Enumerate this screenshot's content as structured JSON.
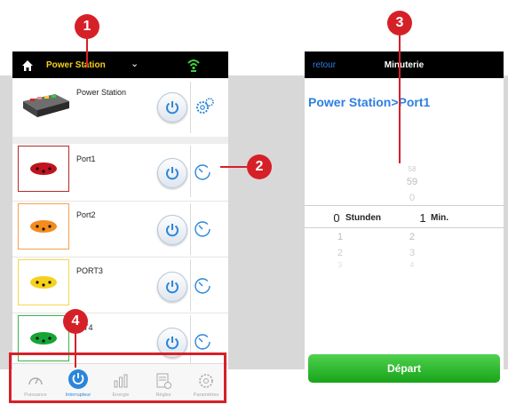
{
  "left_screen": {
    "topbar": {
      "title": "Power Station",
      "icon_home": "home-icon",
      "icon_wifi": "wifi-icon"
    },
    "station": {
      "label": "Power Station"
    },
    "ports": [
      {
        "label": "Port1",
        "color": "#c1121f",
        "border": "#b22a2a"
      },
      {
        "label": "Port2",
        "color": "#f28c1e",
        "border": "#f3a24b"
      },
      {
        "label": "PORT3",
        "color": "#f6d11c",
        "border": "#f6d64b"
      },
      {
        "label": "T4",
        "color": "#16a534",
        "border": "#39b54a"
      }
    ],
    "tabs": [
      {
        "label": "Puissance",
        "icon": "gauge-icon"
      },
      {
        "label": "Interrupteur",
        "icon": "power-icon",
        "active": true
      },
      {
        "label": "Energie",
        "icon": "bar-chart-icon"
      },
      {
        "label": "Règles",
        "icon": "rules-icon"
      },
      {
        "label": "Paramètres",
        "icon": "gear-icon"
      }
    ]
  },
  "right_screen": {
    "back_label": "retour",
    "title": "Minuterie",
    "heading": "Power Station>Port1",
    "hours": {
      "above": [
        "",
        "",
        ""
      ],
      "selected": "0",
      "unit": "Stunden",
      "below": [
        "1",
        "2",
        "3"
      ]
    },
    "minutes": {
      "above": [
        "58",
        "59",
        "0"
      ],
      "selected": "1",
      "unit": "Min.",
      "below": [
        "2",
        "3",
        "4"
      ]
    },
    "start_label": "Départ"
  },
  "callouts": [
    "1",
    "2",
    "3",
    "4"
  ],
  "colors": {
    "accent_red": "#d62028",
    "ios_blue": "#2d7fe0",
    "start_green": "#22b022",
    "title_yellow": "#f5d020"
  }
}
